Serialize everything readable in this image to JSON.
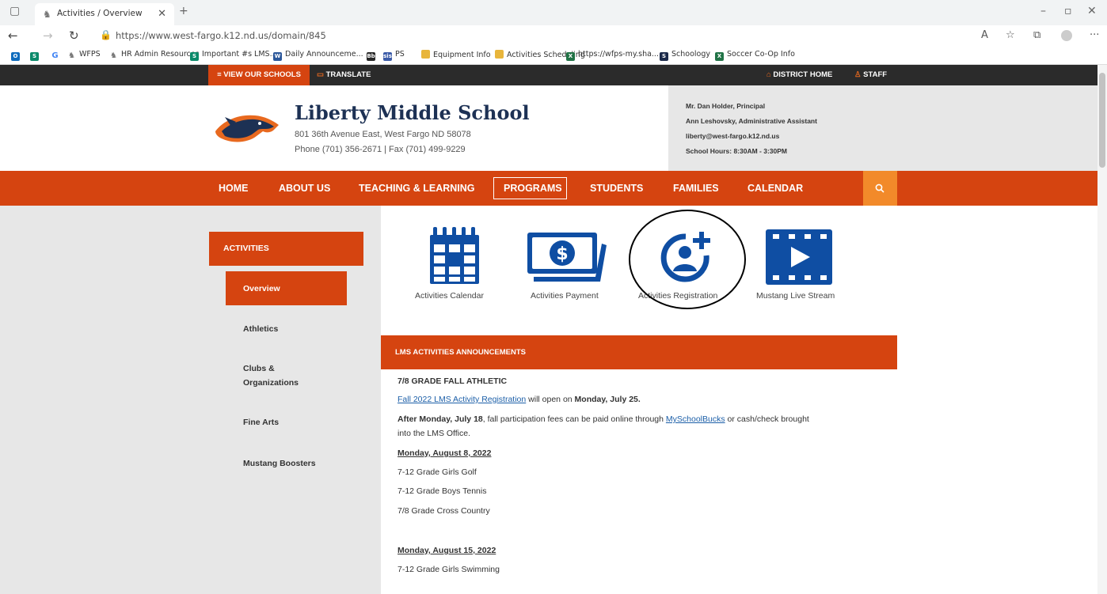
{
  "browser": {
    "tab_title": "Activities / Overview",
    "url": "https://www.west-fargo.k12.nd.us/domain/845",
    "bookmarks": [
      {
        "label": "",
        "icon": "outlook-icon",
        "color": "#0f6cbd"
      },
      {
        "label": "",
        "icon": "sharepoint-icon",
        "color": "#0b8a6a"
      },
      {
        "label": "",
        "icon": "google-icon",
        "color": "#4285f4"
      },
      {
        "label": "WFPS",
        "icon": "mustang-favicon"
      },
      {
        "label": "HR Admin Resources",
        "icon": "mustang-favicon"
      },
      {
        "label": "Important #s LMS...",
        "icon": "sharepoint-icon",
        "color": "#0b8a6a"
      },
      {
        "label": "Daily Announceme...",
        "icon": "word-icon",
        "color": "#2b579a"
      },
      {
        "label": "",
        "icon": "blackboard-icon",
        "color": "#262626"
      },
      {
        "label": "PS",
        "icon": "sis-icon",
        "color": "#3b5ba8"
      },
      {
        "label": "Equipment Info",
        "icon": "folder-icon",
        "color": "#e8b53b"
      },
      {
        "label": "Activities Scheduling",
        "icon": "folder-icon",
        "color": "#e8b53b"
      },
      {
        "label": "https://wfps-my.sha...",
        "icon": "excel-icon",
        "color": "#217346"
      },
      {
        "label": "Schoology",
        "icon": "schoology-icon",
        "color": "#1b2a4a"
      },
      {
        "label": "Soccer Co-Op Info",
        "icon": "excel-icon",
        "color": "#217346"
      }
    ]
  },
  "topbar": {
    "view_schools": "VIEW OUR SCHOOLS",
    "translate": "TRANSLATE",
    "district_home": "DISTRICT HOME",
    "staff": "STAFF"
  },
  "header": {
    "school_name": "Liberty Middle School",
    "address": "801 36th Avenue East, West Fargo ND 58078",
    "phone": "Phone (701) 356-2671  |  Fax (701) 499-9229",
    "principal": "Mr. Dan Holder, Principal",
    "assistant": "Ann Leshovsky, Administrative Assistant",
    "email": "liberty@west-fargo.k12.nd.us",
    "hours": "School Hours: 8:30AM - 3:30PM"
  },
  "nav": {
    "items": [
      "HOME",
      "ABOUT US",
      "TEACHING & LEARNING",
      "PROGRAMS",
      "STUDENTS",
      "FAMILIES",
      "CALENDAR"
    ],
    "active": "PROGRAMS"
  },
  "sidebar": {
    "section": "ACTIVITIES",
    "active": "Overview",
    "links": [
      "Athletics",
      "Clubs &",
      "Organizations",
      "Fine Arts",
      "Mustang Boosters"
    ]
  },
  "quick_links": [
    {
      "label": "Activities Calendar",
      "icon": "calendar-icon"
    },
    {
      "label": "Activities Payment",
      "icon": "payment-icon"
    },
    {
      "label": "Activities Registration",
      "icon": "add-user-icon"
    },
    {
      "label": "Mustang Live Stream",
      "icon": "video-icon"
    }
  ],
  "announcements": {
    "header": "LMS ACTIVITIES ANNOUNCEMENTS",
    "heading": "7/8 GRADE FALL ATHLETIC",
    "registration_link": "Fall 2022 LMS Activity Registration",
    "registration_mid": " will open on ",
    "registration_date": "Monday, July 25.",
    "fees_bold": "After Monday, July 18",
    "fees_mid": ", fall participation fees can be paid online through ",
    "fees_link": "MySchoolBucks",
    "fees_end": " or cash/check brought",
    "fees_line2": "into the LMS Office.",
    "date1": "Monday, August 8, 2022",
    "group1": [
      "7-12 Grade Girls Golf",
      "7-12 Grade Boys Tennis",
      "7/8 Grade Cross Country"
    ],
    "date2": "Monday, August 15, 2022",
    "group2": [
      "7-12 Grade Girls Swimming"
    ]
  },
  "colors": {
    "brand_orange": "#d54410",
    "navy": "#1d3154",
    "icon_blue": "#0f4ea3",
    "search_orange": "#f28a2a"
  }
}
